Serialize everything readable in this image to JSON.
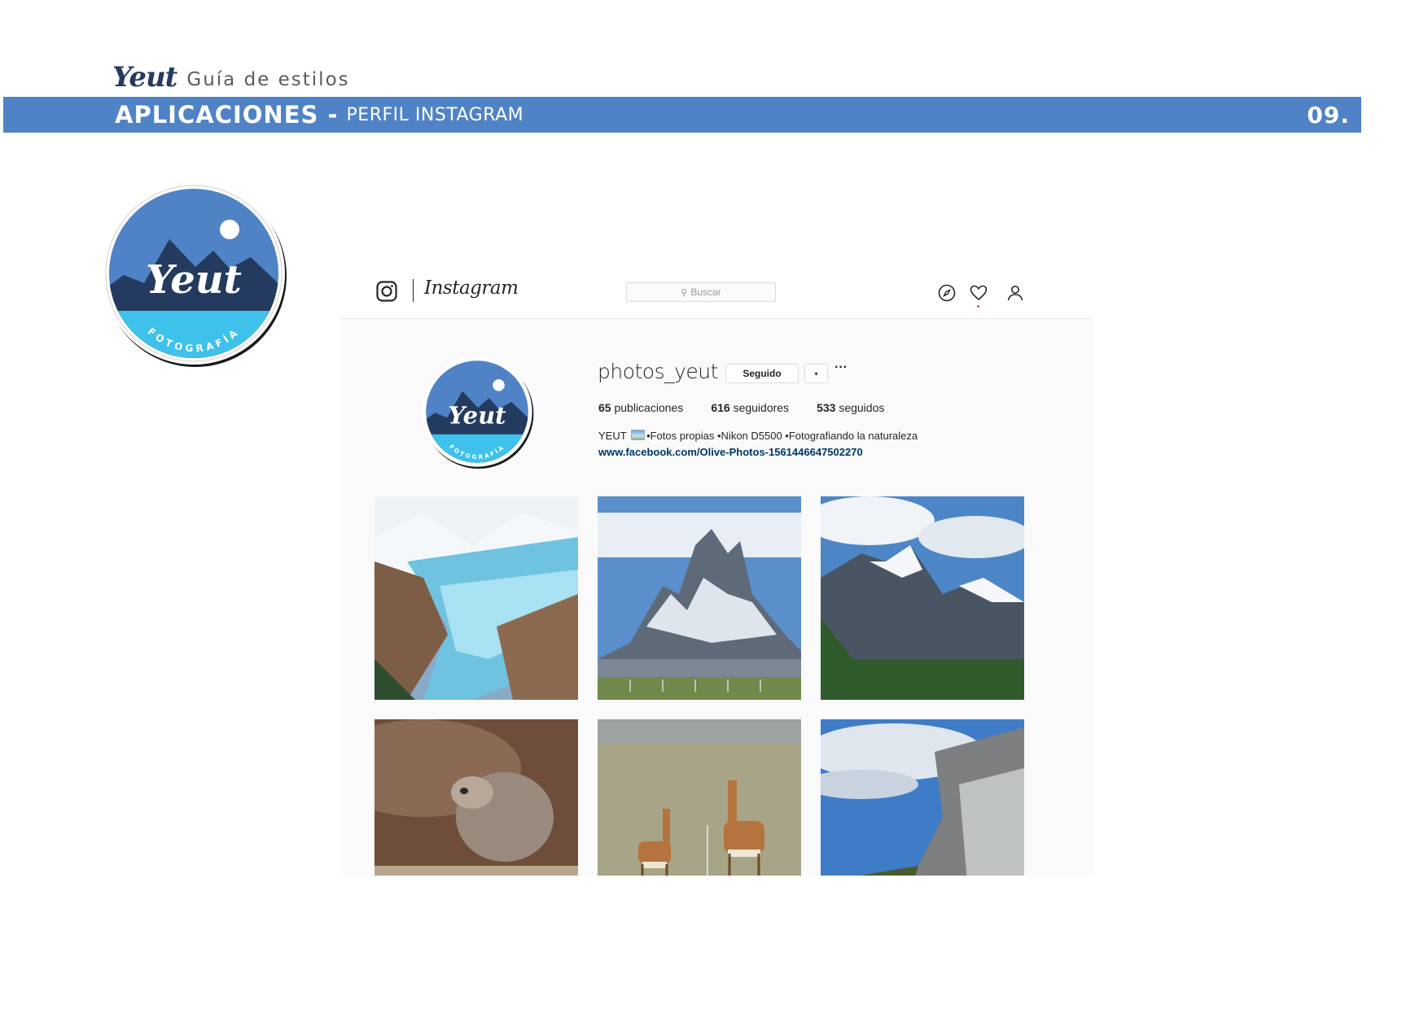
{
  "guide": {
    "brand": "Yeut",
    "subtitle": "Guía de estilos",
    "section_title": "APLICACIONES -",
    "section_subtitle": "PERFIL INSTAGRAM",
    "page_number": "09."
  },
  "logo": {
    "name": "Yeut",
    "tagline": "FOTOGRAFÍA",
    "colors": {
      "sky": "#4f83c5",
      "mountain": "#243a5e",
      "band": "#3ec1ea",
      "moon": "#ffffff"
    }
  },
  "instagram": {
    "icons": [
      "instagram-camera-icon",
      "compass-icon",
      "heart-icon",
      "user-icon",
      "search-icon"
    ],
    "wordmark": "Instagram",
    "search_placeholder": "Buscar",
    "username": "photos_yeut",
    "follow_button": "Seguido",
    "dropdown_symbol": "▾",
    "more_symbol": "···",
    "stats": [
      {
        "count": "65",
        "label": "publicaciones"
      },
      {
        "count": "616",
        "label": "seguidores"
      },
      {
        "count": "533",
        "label": "seguidos"
      }
    ],
    "bio_name": "YEUT",
    "bio_text": "•Fotos propias •Nikon D5500 •Fotografiando la naturaleza",
    "website": "www.facebook.com/Olive-Photos-1561446647502270",
    "posts": [
      {
        "subject": "glacier"
      },
      {
        "subject": "fitz-roy-peaks"
      },
      {
        "subject": "snowy-mountain-forest"
      },
      {
        "subject": "sea-lion"
      },
      {
        "subject": "guanacos"
      },
      {
        "subject": "rock-cliff"
      }
    ]
  }
}
